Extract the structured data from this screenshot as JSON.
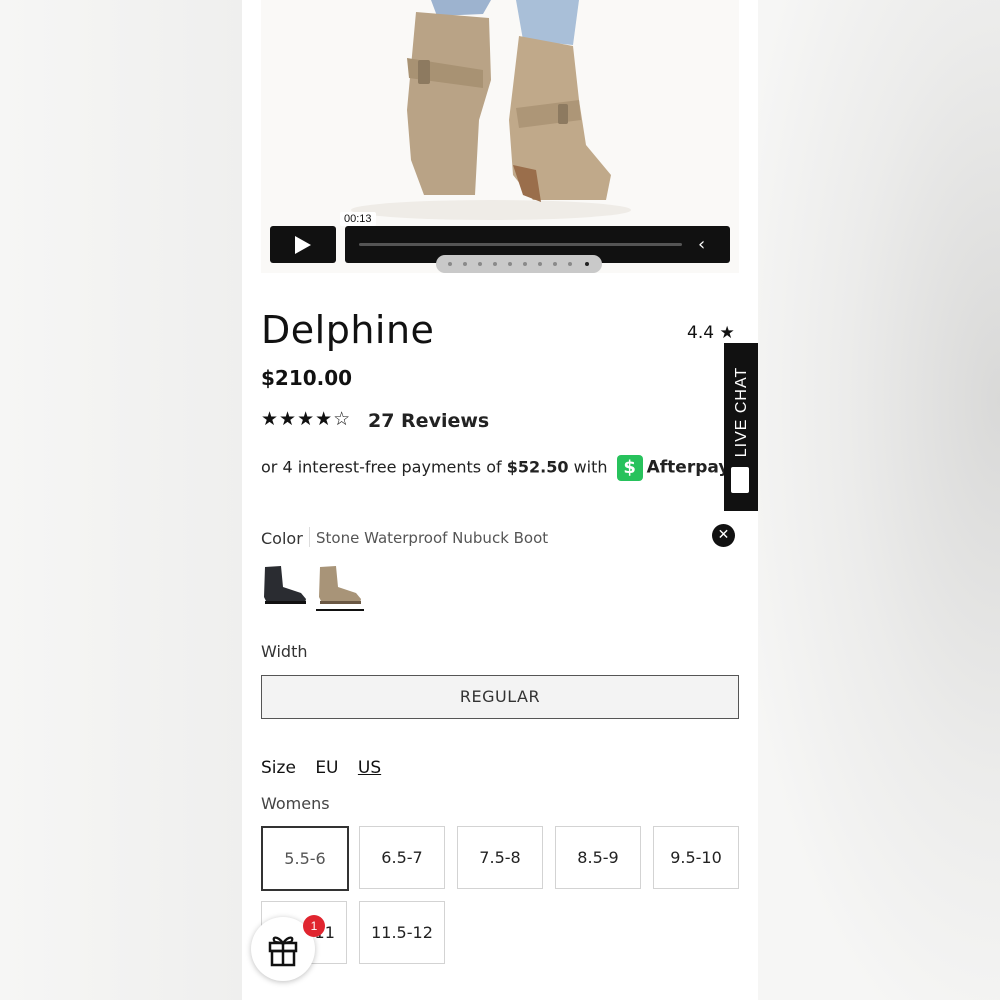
{
  "media": {
    "timestamp": "00:13",
    "carousel_count": 10,
    "carousel_active": 9
  },
  "product": {
    "name": "Delphine",
    "price": "$210.00",
    "rating_top": "4.4 ★",
    "stars": "★★★★☆",
    "reviews": "27 Reviews"
  },
  "afterpay": {
    "prefix": "or 4 interest-free payments of",
    "amount": "$52.50",
    "mid": "with",
    "brand": "Afterpay",
    "badge": "$"
  },
  "live_chat": {
    "label": "LIVE CHAT"
  },
  "color": {
    "label": "Color",
    "value": "Stone Waterproof Nubuck Boot"
  },
  "width": {
    "label": "Width",
    "option": "REGULAR"
  },
  "size": {
    "label": "Size",
    "systems": [
      "EU",
      "US"
    ],
    "active_system": "US",
    "group": "Womens",
    "options": [
      "5.5-6",
      "6.5-7",
      "7.5-8",
      "8.5-9",
      "9.5-10",
      "10.5-11",
      "11.5-12"
    ],
    "selected": "5.5-6"
  },
  "gift": {
    "badge_count": "1"
  },
  "colors": {
    "afterpay_green": "#27c25c",
    "badge_red": "#e0252f"
  }
}
